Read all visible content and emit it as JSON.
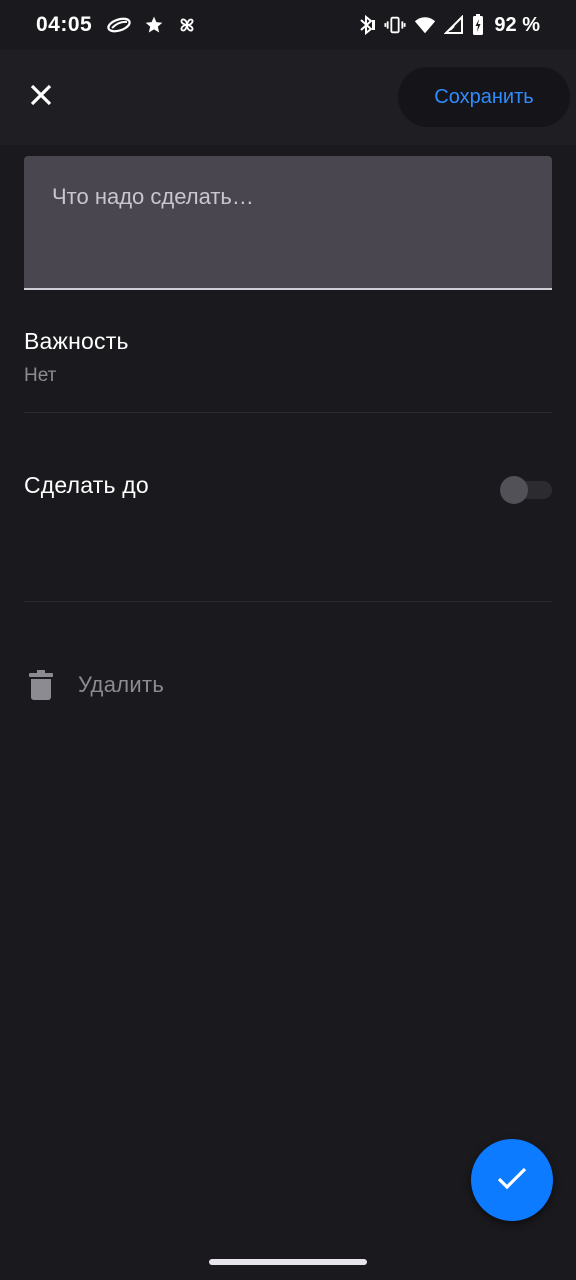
{
  "status_bar": {
    "time": "04:05",
    "battery_text": "92 %",
    "icons_left": [
      "cloud-icon",
      "star-icon",
      "pinwheel-icon"
    ],
    "icons_right": [
      "bluetooth-icon",
      "vibrate-icon",
      "wifi-icon",
      "signal-icon",
      "battery-icon"
    ]
  },
  "top_bar": {
    "close_icon": "close-icon",
    "save_label": "Сохранить"
  },
  "task_input": {
    "placeholder": "Что надо сделать…",
    "value": ""
  },
  "importance": {
    "title": "Важность",
    "value": "Нет"
  },
  "deadline": {
    "label": "Сделать до",
    "enabled": false
  },
  "delete": {
    "label": "Удалить",
    "icon": "trash-icon"
  },
  "fab": {
    "icon": "check-icon"
  },
  "colors": {
    "background": "#1a191d",
    "top_bar": "#1f1e22",
    "accent": "#0d7bff",
    "save_text": "#2f8cff",
    "input_fill": "#4a4650",
    "secondary_text": "#8d8b92"
  }
}
